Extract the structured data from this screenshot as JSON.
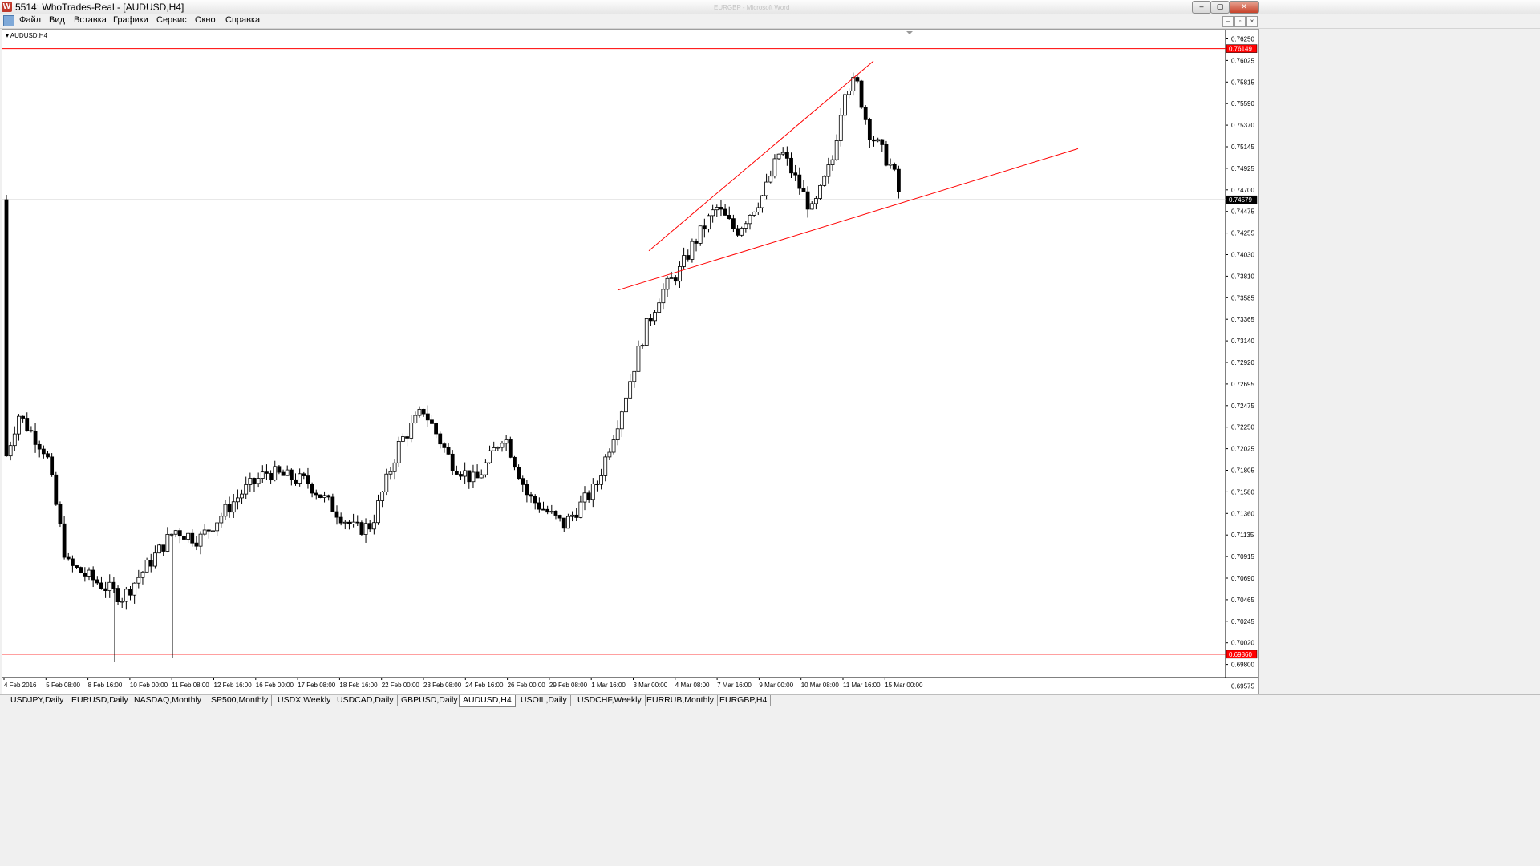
{
  "window": {
    "title": "5514: WhoTrades-Real - [AUDUSD,H4]",
    "background_title": "EURGBP - Microsoft Word",
    "app_icon": "W",
    "controls": {
      "minimize": "–",
      "maximize": "▢",
      "close": "✕"
    }
  },
  "menu": {
    "icon": "chart-window-icon",
    "items": [
      "Файл",
      "Вид",
      "Вставка",
      "Графики",
      "Сервис",
      "Окно",
      "Справка"
    ],
    "mdi_controls": {
      "minimize": "–",
      "restore": "▫",
      "close": "×"
    }
  },
  "chart": {
    "label": "AUDUSD,H4",
    "colors": {
      "bull_candle": "#ffffff",
      "bear_candle": "#000000",
      "trendline": "#ff0000",
      "level": "#ff0000",
      "current_price_line": "#c0c0c0"
    },
    "price_scale": [
      "0.76250",
      "0.76025",
      "0.75815",
      "0.75590",
      "0.75370",
      "0.75145",
      "0.74925",
      "0.74700",
      "0.74475",
      "0.74255",
      "0.74030",
      "0.73810",
      "0.73585",
      "0.73365",
      "0.73140",
      "0.72920",
      "0.72695",
      "0.72475",
      "0.72250",
      "0.72025",
      "0.71805",
      "0.71580",
      "0.71360",
      "0.71135",
      "0.70915",
      "0.70690",
      "0.70465",
      "0.70245",
      "0.70020",
      "0.69800",
      "0.69575"
    ],
    "current_price": "0.74579",
    "resistance_level": "0.76149",
    "support_level": "0.69860",
    "time_axis": [
      "4 Feb 2016",
      "5 Feb 08:00",
      "8 Feb 16:00",
      "10 Feb 00:00",
      "11 Feb 08:00",
      "12 Feb 16:00",
      "16 Feb 00:00",
      "17 Feb 08:00",
      "18 Feb 16:00",
      "22 Feb 00:00",
      "23 Feb 08:00",
      "24 Feb 16:00",
      "26 Feb 00:00",
      "29 Feb 08:00",
      "1 Mar 16:00",
      "3 Mar 00:00",
      "4 Mar 08:00",
      "7 Mar 16:00",
      "9 Mar 00:00",
      "10 Mar 08:00",
      "11 Mar 16:00",
      "15 Mar 00:00"
    ]
  },
  "tabs": [
    {
      "label": "USDJPY,Daily",
      "active": false
    },
    {
      "label": "EURUSD,Daily",
      "active": false
    },
    {
      "label": "NASDAQ,Monthly",
      "active": false
    },
    {
      "label": "SP500,Monthly",
      "active": false
    },
    {
      "label": "USDX,Weekly",
      "active": false
    },
    {
      "label": "USDCAD,Daily",
      "active": false
    },
    {
      "label": "GBPUSD,Daily",
      "active": false
    },
    {
      "label": "AUDUSD,H4",
      "active": true
    },
    {
      "label": "USOIL,Daily",
      "active": false
    },
    {
      "label": "USDCHF,Weekly",
      "active": false
    },
    {
      "label": "EURRUB,Monthly",
      "active": false
    },
    {
      "label": "EURGBP,H4",
      "active": false
    }
  ]
}
